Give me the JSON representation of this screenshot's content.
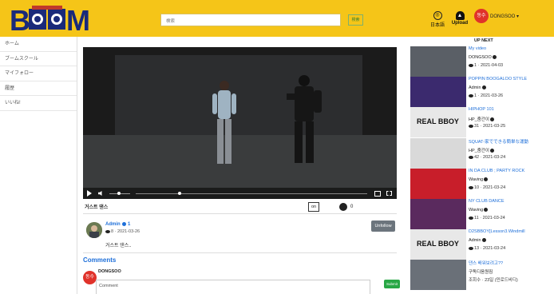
{
  "header": {
    "logo_text": "BOOM",
    "search_placeholder": "検索",
    "search_button": "検索",
    "language_label": "日本語",
    "upload_label": "Upload",
    "avatar_text": "동수",
    "username": "DONGSOO",
    "accent_color": "#f5c518"
  },
  "sidebar": {
    "items": [
      {
        "label": "ホーム"
      },
      {
        "label": "ブームスクール"
      },
      {
        "label": "マイフォロー"
      },
      {
        "label": "履歴"
      },
      {
        "label": "いいね!"
      }
    ]
  },
  "player": {
    "progress_fraction": 0.19,
    "volume_fraction": 0.45
  },
  "video": {
    "title": "거스트 댄스",
    "toggle_label": "on",
    "like_count": "0"
  },
  "uploader": {
    "name": "Admin",
    "follower_count": "1",
    "views": "8",
    "date": "2021-03-26",
    "description": "거스트 댄스..",
    "unfollow_label": "Unfollow"
  },
  "comments": {
    "heading": "Comments",
    "avatar_text": "동수",
    "username": "DONGSOO",
    "input_placeholder": "Comment",
    "submit_label": "Submit"
  },
  "up_next": {
    "heading": "UP NEXT",
    "items": [
      {
        "title": "My video",
        "author": "DONGSOO",
        "views": "1",
        "date": "2021-04-03",
        "thumb": "#5a5f66"
      },
      {
        "title": "POPPIN BOOGALOO STYLE",
        "author": "Admin",
        "views": "1",
        "date": "2021-03-26",
        "thumb": "#3b2a6e"
      },
      {
        "title": "HIPHOP 101",
        "author": "HP_줌간이",
        "views": "31",
        "date": "2021-03-25",
        "thumb": "#e8e8e8",
        "thumb_text": "REAL BBOY"
      },
      {
        "title": "SQUAT-家でできる簡単な運動",
        "author": "HP_줌간이",
        "views": "42",
        "date": "2021-03-24",
        "thumb": "#d9d9d9"
      },
      {
        "title": "IN DA CLUB ; PARTY ROCK",
        "author": "Waving",
        "views": "10",
        "date": "2021-03-24",
        "thumb": "#c81e2a"
      },
      {
        "title": "NY CLUB DANCE",
        "author": "Waving",
        "views": "11",
        "date": "2021-03-24",
        "thumb": "#5a2a5e"
      },
      {
        "title": "D2SBBOY[Lesson3.Windmill",
        "author": "Admin",
        "views": "13",
        "date": "2021-03-24",
        "thumb": "#e8e8e8",
        "thumb_text": "REAL BBOY"
      },
      {
        "title": "댄스 배워보려고??",
        "author": "구독디음원짐",
        "views": "",
        "date": "",
        "thumb": "#6a7078",
        "meta_text": "조회수 · 23일 (민로드비디)"
      }
    ]
  }
}
